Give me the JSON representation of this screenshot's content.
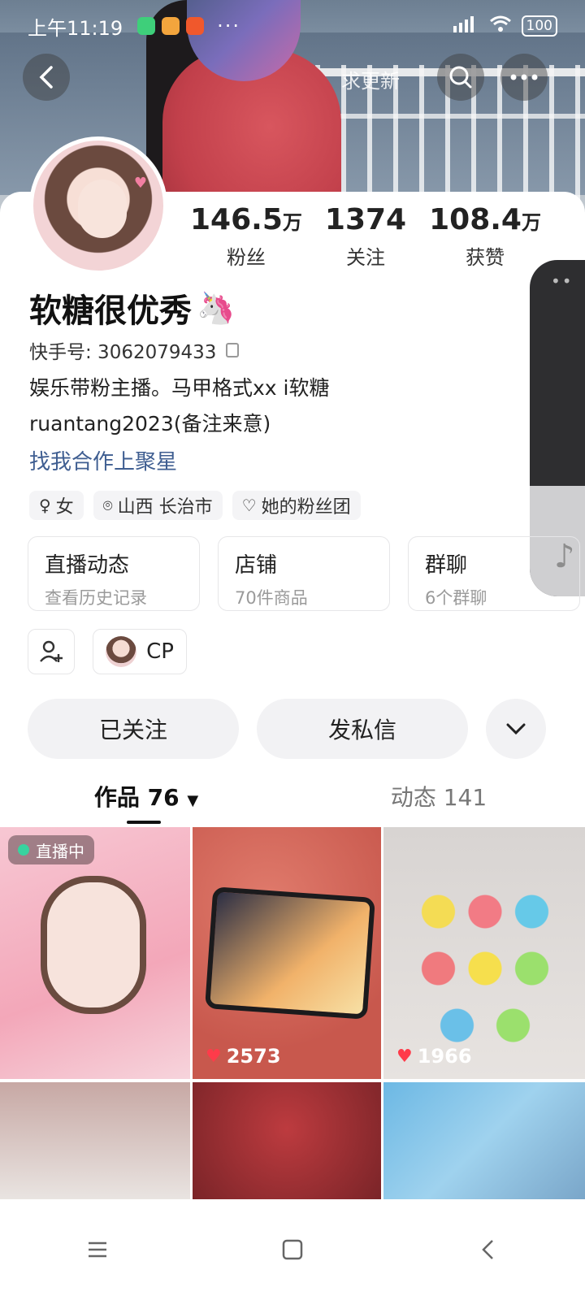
{
  "status_bar": {
    "time": "上午11:19",
    "more": "···",
    "battery": "100"
  },
  "header": {
    "title": "求更新"
  },
  "profile": {
    "stats": [
      {
        "num": "146.5",
        "unit": "万",
        "label": "粉丝"
      },
      {
        "num": "1374",
        "unit": "",
        "label": "关注"
      },
      {
        "num": "108.4",
        "unit": "万",
        "label": "获赞"
      }
    ],
    "name": "软糖很优秀",
    "name_emoji": "🦄",
    "uid_label": "快手号: 3062079433",
    "bio_line1": "娱乐带粉主播。马甲格式xx  i软糖",
    "bio_line2": "ruantang2023(备注来意)",
    "cooperation": "找我合作上聚星",
    "tags": [
      {
        "icon": "gender-female-icon",
        "text": "女"
      },
      {
        "icon": "location-icon",
        "text": "山西 长治市"
      },
      {
        "icon": "heart-outline-icon",
        "text": "她的粉丝团"
      }
    ]
  },
  "cards": [
    {
      "title": "直播动态",
      "subtitle": "查看历史记录"
    },
    {
      "title": "店铺",
      "subtitle": "70件商品"
    },
    {
      "title": "群聊",
      "subtitle": "6个群聊"
    }
  ],
  "cp_label": "CP",
  "actions": {
    "follow": "已关注",
    "message": "发私信"
  },
  "tabs": {
    "works": "作品 76",
    "moments": "动态 141"
  },
  "grid": {
    "live_label": "直播中",
    "likes": [
      "2573",
      "1966"
    ]
  }
}
